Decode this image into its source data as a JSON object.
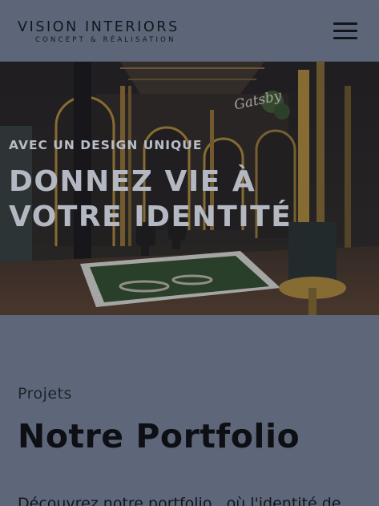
{
  "header": {
    "logo_title": "VISION INTERIORS",
    "logo_subtitle": "CONCEPT & RÉALISATION",
    "menu_icon": "hamburger-menu-icon"
  },
  "hero": {
    "eyebrow": "AVEC UN DESIGN UNIQUE",
    "title": "DONNEZ VIE À VOTRE IDENTITÉ",
    "image_sign_text": "Gatsby"
  },
  "portfolio": {
    "label": "Projets",
    "title": "Notre Portfolio",
    "intro": "Découvrez notre portfolio , où l'identité de"
  },
  "colors": {
    "page_bg": "#5e6779",
    "text_dark": "#12151c",
    "hero_text": "#b3b8c2",
    "gold_accent": "#b8902e"
  }
}
